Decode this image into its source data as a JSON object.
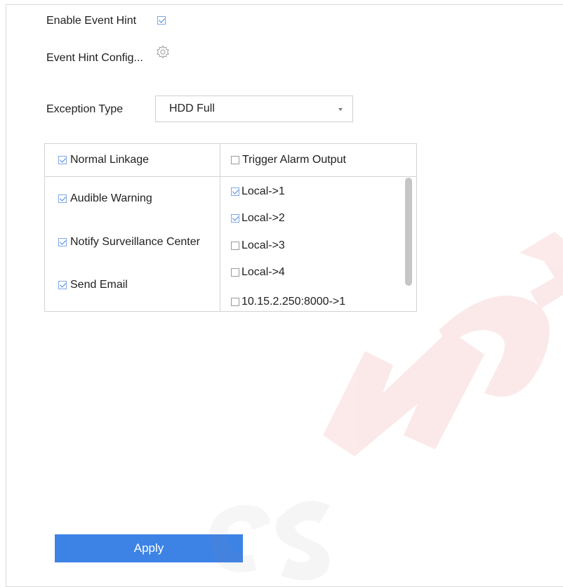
{
  "event_hint": {
    "enable_label": "Enable Event Hint",
    "enable_checked": true,
    "config_label": "Event Hint Config..."
  },
  "exception": {
    "label": "Exception Type",
    "selected": "HDD Full"
  },
  "linkage": {
    "normal_header": "Normal Linkage",
    "normal_header_checked": true,
    "trigger_header": "Trigger Alarm Output",
    "trigger_header_checked": false,
    "normal_items": [
      {
        "label": "Audible Warning",
        "checked": true
      },
      {
        "label": "Notify Surveillance Center",
        "checked": true
      },
      {
        "label": "Send Email",
        "checked": true
      }
    ],
    "trigger_items": [
      {
        "label": "Local->1",
        "checked": true
      },
      {
        "label": "Local->2",
        "checked": true
      },
      {
        "label": "Local->3",
        "checked": false
      },
      {
        "label": "Local->4",
        "checked": false
      },
      {
        "label": "10.15.2.250:8000->1",
        "checked": false
      }
    ]
  },
  "apply_label": "Apply",
  "colors": {
    "accent": "#3d83e6",
    "watermark": "#e03030"
  }
}
